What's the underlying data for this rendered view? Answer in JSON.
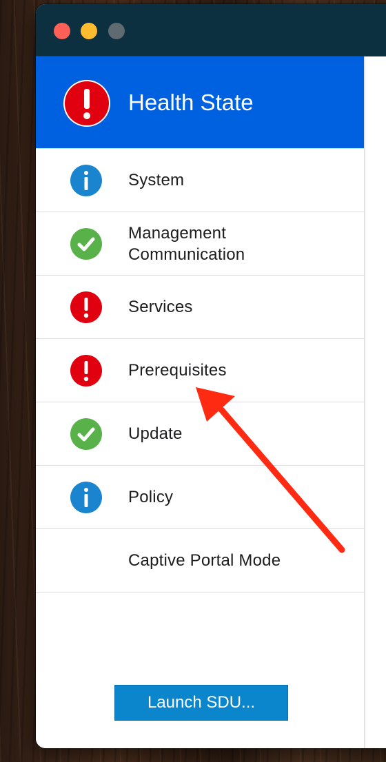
{
  "window": {
    "traffic_lights": [
      "close",
      "minimize",
      "zoom"
    ]
  },
  "header": {
    "icon": "error-icon",
    "title": "Health State"
  },
  "items": [
    {
      "label": "System",
      "status": "info"
    },
    {
      "label": "Management Communication",
      "status": "ok"
    },
    {
      "label": "Services",
      "status": "error"
    },
    {
      "label": "Prerequisites",
      "status": "error"
    },
    {
      "label": "Update",
      "status": "ok"
    },
    {
      "label": "Policy",
      "status": "info"
    },
    {
      "label": "Captive Portal Mode",
      "status": "none"
    }
  ],
  "footer": {
    "launch_label": "Launch SDU..."
  },
  "colors": {
    "header_bg": "#0061e0",
    "error": "#e0000f",
    "ok": "#59b249",
    "info": "#1a84cf",
    "button": "#0b86cd",
    "annotation_arrow": "#ff2a12"
  }
}
